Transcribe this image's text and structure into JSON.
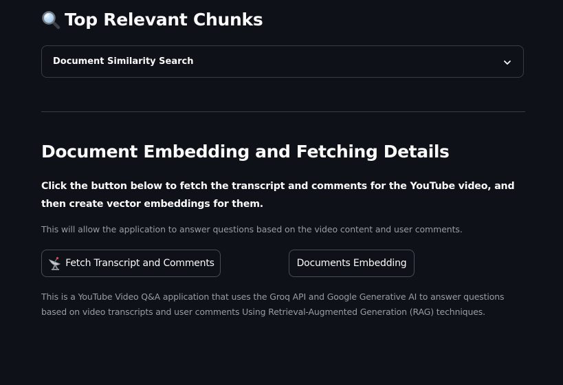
{
  "section": {
    "icon": "magnifying-glass-icon",
    "title": "Top Relevant Chunks"
  },
  "expander": {
    "label": "Document Similarity Search",
    "icon": "chevron-down-icon",
    "expanded": false
  },
  "embedding": {
    "heading": "Document Embedding and Fetching Details",
    "instruction": "Click the button below to fetch the transcript and comments for the YouTube video, and then create vector embeddings for them.",
    "caption": "This will allow the application to answer questions based on the video content and user comments."
  },
  "buttons": {
    "fetch": {
      "icon": "satellite-antenna-icon",
      "label": "Fetch Transcript and Comments"
    },
    "embed": {
      "label": "Documents Embedding"
    }
  },
  "footer": {
    "text": "This is a YouTube Video Q&A application that uses the Groq API and Google Generative AI to answer questions based on video transcripts and user comments Using Retrieval-Augmented Generation (RAG) techniques."
  },
  "colors": {
    "background": "#0e1117",
    "text": "#fafafa",
    "muted_text": "#9a9ca3",
    "border": "#3a3d46"
  }
}
